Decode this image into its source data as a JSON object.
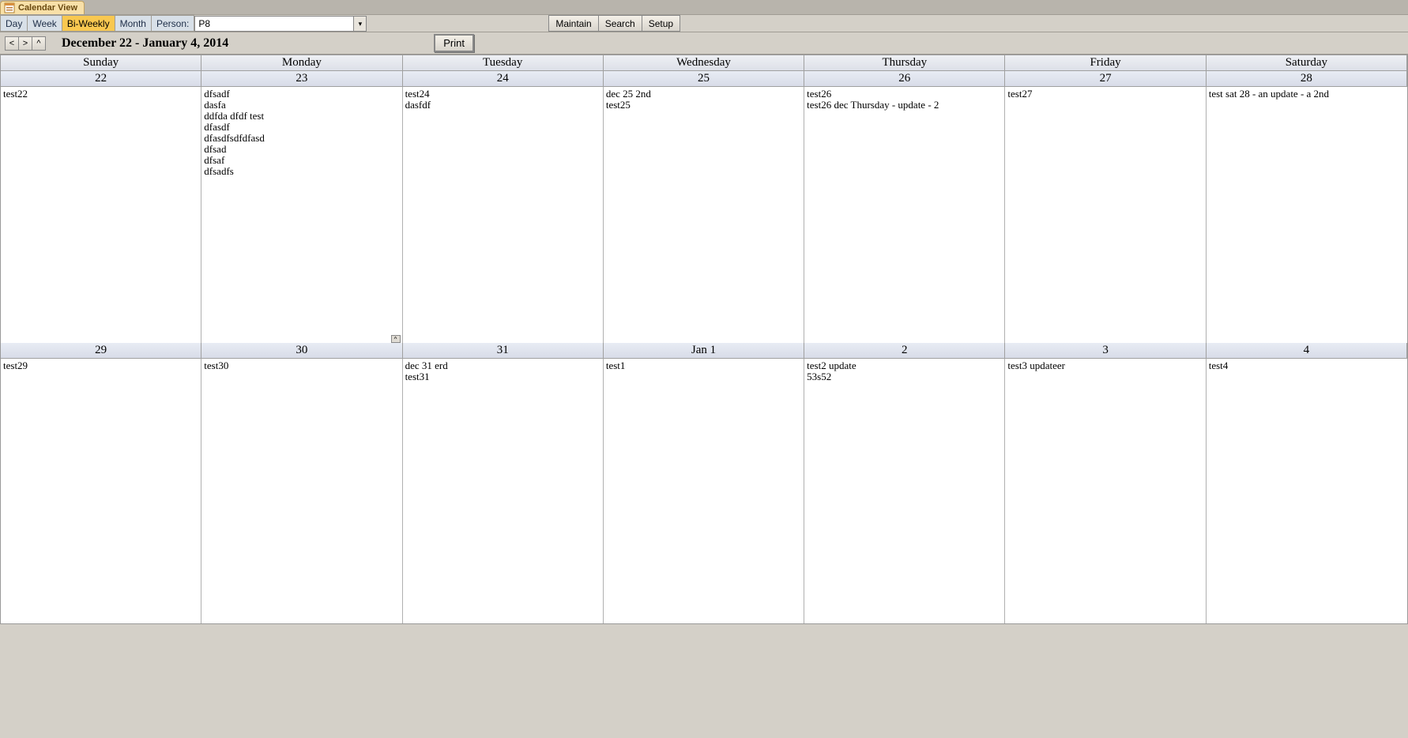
{
  "window": {
    "title": "Calendar View"
  },
  "toolbar": {
    "views": [
      {
        "label": "Day",
        "active": false
      },
      {
        "label": "Week",
        "active": false
      },
      {
        "label": "Bi-Weekly",
        "active": true
      },
      {
        "label": "Month",
        "active": false
      }
    ],
    "person_label": "Person:",
    "person_value": "P8",
    "actions": [
      {
        "label": "Maintain"
      },
      {
        "label": "Search"
      },
      {
        "label": "Setup"
      }
    ]
  },
  "nav": {
    "prev": "<",
    "next": ">",
    "up": "^",
    "date_title": "December 22 - January 4, 2014",
    "print": "Print"
  },
  "calendar": {
    "dow": [
      "Sunday",
      "Monday",
      "Tuesday",
      "Wednesday",
      "Thursday",
      "Friday",
      "Saturday"
    ],
    "weeks": [
      {
        "dates": [
          "22",
          "23",
          "24",
          "25",
          "26",
          "27",
          "28"
        ],
        "cells": [
          {
            "events": [
              "test22"
            ]
          },
          {
            "events": [
              "dfsadf",
              "dasfa",
              "ddfda dfdf test",
              "dfasdf",
              "dfasdfsdfdfasd",
              "dfsad",
              "dfsaf",
              "dfsadfs"
            ],
            "scroll": true
          },
          {
            "events": [
              "test24",
              "dasfdf"
            ]
          },
          {
            "events": [
              "dec 25 2nd",
              "test25"
            ]
          },
          {
            "events": [
              "test26",
              "test26 dec Thursday - update - 2"
            ]
          },
          {
            "events": [
              "test27"
            ]
          },
          {
            "events": [
              "test sat 28 - an update - a 2nd"
            ]
          }
        ]
      },
      {
        "dates": [
          "29",
          "30",
          "31",
          "Jan 1",
          "2",
          "3",
          "4"
        ],
        "cells": [
          {
            "events": [
              "test29"
            ]
          },
          {
            "events": [
              "test30"
            ]
          },
          {
            "events": [
              "dec 31 erd",
              "test31"
            ]
          },
          {
            "events": [
              "test1"
            ]
          },
          {
            "events": [
              "test2 update",
              "53s52"
            ]
          },
          {
            "events": [
              "test3 updateer"
            ]
          },
          {
            "events": [
              "test4"
            ]
          }
        ]
      }
    ],
    "scroll_up_glyph": "^"
  }
}
